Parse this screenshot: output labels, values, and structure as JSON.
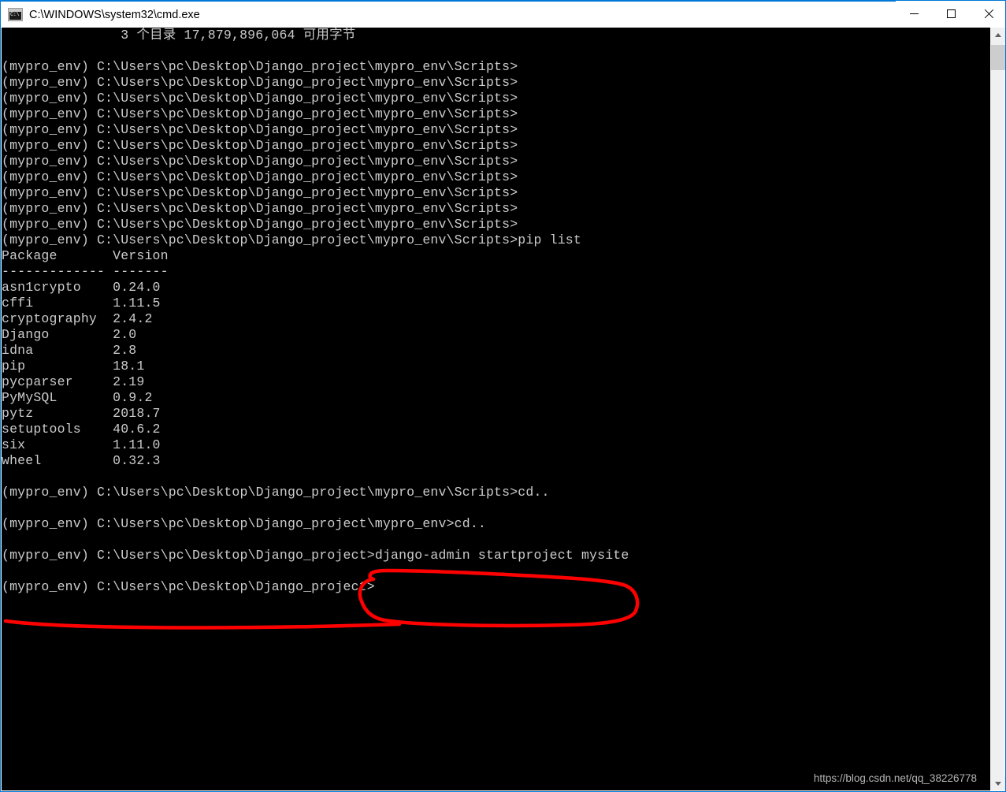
{
  "window": {
    "title": "C:\\WINDOWS\\system32\\cmd.exe",
    "icon": "cmd-icon",
    "controls": {
      "minimize_label": "Minimize",
      "maximize_label": "Maximize",
      "close_label": "Close"
    }
  },
  "terminal": {
    "background_color": "#000000",
    "text_color": "#cccccc",
    "lines": [
      "               3 个目录 17,879,896,064 可用字节",
      "",
      "(mypro_env) C:\\Users\\pc\\Desktop\\Django_project\\mypro_env\\Scripts>",
      "(mypro_env) C:\\Users\\pc\\Desktop\\Django_project\\mypro_env\\Scripts>",
      "(mypro_env) C:\\Users\\pc\\Desktop\\Django_project\\mypro_env\\Scripts>",
      "(mypro_env) C:\\Users\\pc\\Desktop\\Django_project\\mypro_env\\Scripts>",
      "(mypro_env) C:\\Users\\pc\\Desktop\\Django_project\\mypro_env\\Scripts>",
      "(mypro_env) C:\\Users\\pc\\Desktop\\Django_project\\mypro_env\\Scripts>",
      "(mypro_env) C:\\Users\\pc\\Desktop\\Django_project\\mypro_env\\Scripts>",
      "(mypro_env) C:\\Users\\pc\\Desktop\\Django_project\\mypro_env\\Scripts>",
      "(mypro_env) C:\\Users\\pc\\Desktop\\Django_project\\mypro_env\\Scripts>",
      "(mypro_env) C:\\Users\\pc\\Desktop\\Django_project\\mypro_env\\Scripts>",
      "(mypro_env) C:\\Users\\pc\\Desktop\\Django_project\\mypro_env\\Scripts>",
      "(mypro_env) C:\\Users\\pc\\Desktop\\Django_project\\mypro_env\\Scripts>pip list",
      "Package       Version",
      "------------- -------",
      "asn1crypto    0.24.0",
      "cffi          1.11.5",
      "cryptography  2.4.2",
      "Django        2.0",
      "idna          2.8",
      "pip           18.1",
      "pycparser     2.19",
      "PyMySQL       0.9.2",
      "pytz          2018.7",
      "setuptools    40.6.2",
      "six           1.11.0",
      "wheel         0.32.3",
      "",
      "(mypro_env) C:\\Users\\pc\\Desktop\\Django_project\\mypro_env\\Scripts>cd..",
      "",
      "(mypro_env) C:\\Users\\pc\\Desktop\\Django_project\\mypro_env>cd..",
      "",
      "(mypro_env) C:\\Users\\pc\\Desktop\\Django_project>django-admin startproject mysite",
      "",
      "(mypro_env) C:\\Users\\pc\\Desktop\\Django_project>"
    ],
    "pip_table": {
      "columns": [
        "Package",
        "Version"
      ],
      "rows": [
        [
          "asn1crypto",
          "0.24.0"
        ],
        [
          "cffi",
          "1.11.5"
        ],
        [
          "cryptography",
          "2.4.2"
        ],
        [
          "Django",
          "2.0"
        ],
        [
          "idna",
          "2.8"
        ],
        [
          "pip",
          "18.1"
        ],
        [
          "pycparser",
          "2.19"
        ],
        [
          "PyMySQL",
          "0.9.2"
        ],
        [
          "pytz",
          "2018.7"
        ],
        [
          "setuptools",
          "40.6.2"
        ],
        [
          "six",
          "1.11.0"
        ],
        [
          "wheel",
          "0.32.3"
        ]
      ]
    },
    "commands": [
      "pip list",
      "cd..",
      "cd..",
      "django-admin startproject mysite"
    ],
    "disk_summary": "3 个目录 17,879,896,064 可用字节"
  },
  "annotations": {
    "color": "#ff0000",
    "ellipse_target": "django-admin startproject mysite",
    "underline_target": "(mypro_env) C:\\Users\\pc\\Desktop\\Django_project>"
  },
  "watermark": {
    "text": "https://blog.csdn.net/qq_38226778"
  },
  "scrollbar": {
    "up_arrow": "chevron-up-icon",
    "down_arrow": "chevron-down-icon",
    "track_color": "#f0f0f0",
    "thumb_color": "#cdcdcd"
  }
}
